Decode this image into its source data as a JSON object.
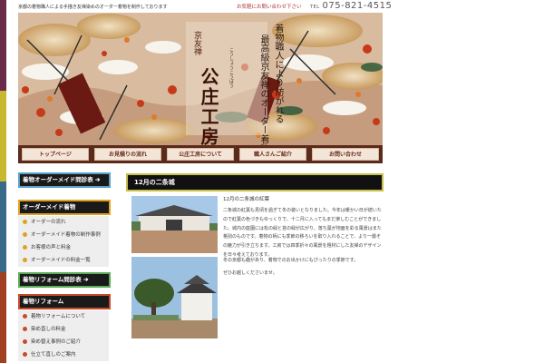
{
  "colors": {
    "stripe": [
      "#6a2a4a",
      "#c8b830",
      "#3a6a8a",
      "#a04020"
    ],
    "nav_bg": "#5a2a1a",
    "nav_button_bg": "#f3e6d8",
    "sidebar_bg": "#eeeeee",
    "header_border": "#c8c04a"
  },
  "header": {
    "tagline": "京都の着物職人による手描き友禅染めのオーダー着物を制作しております",
    "contact_label": "お気軽にお問い合わせ下さい",
    "tel_prefix": "TEL",
    "phone": "075-821-4515"
  },
  "banner": {
    "logo_small": "京友禅",
    "logo_reading": "こうしょうこうぼう",
    "logo_big": "公庄工房",
    "catch_line1": "着物職人により紡がれる",
    "catch_line2": "最高級京友禅のオーダー着物"
  },
  "nav": {
    "items": [
      "トップページ",
      "お見積りの流れ",
      "公庄工房について",
      "職人さんご紹介",
      "お問い合わせ"
    ]
  },
  "sidebar": {
    "banner1": "着物オーダーメイド問診表 ➔",
    "section1_title": "オーダーメイド着物",
    "section1_items": [
      "オーダーの流れ",
      "オーダーメイド着物の制作事例",
      "お客様の声と料金",
      "オーダーメイドの料金一覧"
    ],
    "banner2": "着物リフォーム問診表 ➔",
    "section2_title": "着物リフォーム",
    "section2_items": [
      "着物リフォームについて",
      "染め直しの料金",
      "染め替え事例のご紹介",
      "仕立て直しのご案内"
    ]
  },
  "main": {
    "section_title": "12月の二条城",
    "post_title": "12月の二条城の紅葉",
    "paragraph1": "二条城の紅葉も見頃を過ぎて冬の装いとなりました。今年は暖かい日が続いたので紅葉の色づきもゆっくりで、十二月に入ってもまだ楽しむことができました。城内の庭園には松の緑と苔の緑が広がり、落ち葉が地面を彩る風景はまた格別のものです。着物の柄にも季節の移ろいを取り入れることで、より一層その魅力が引き立ちます。工房では四季折々の風景を題材にした友禅のデザインを日々考えております。",
    "paragraph2": "冬の京都も趣があり、着物でのお出かけにもぴったりの季節です。",
    "paragraph3": "ぜひお越しくださいませ。"
  }
}
